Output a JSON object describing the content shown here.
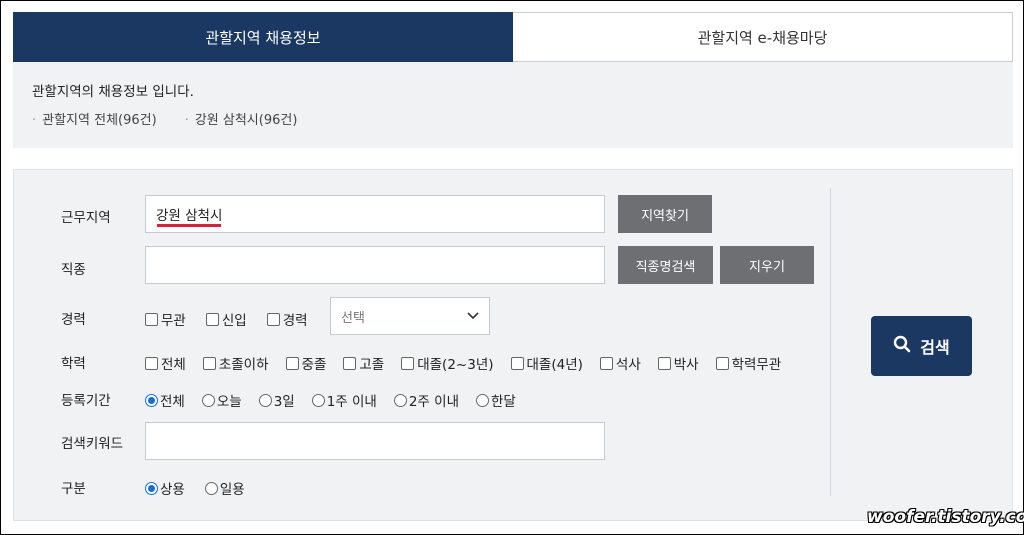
{
  "tabs": [
    {
      "label": "관할지역 채용정보",
      "active": true
    },
    {
      "label": "관할지역 e-채용마당",
      "active": false
    }
  ],
  "info": {
    "title": "관할지역의 채용정보 입니다.",
    "items": [
      "관할지역 전체(96건)",
      "강원 삼척시(96건)"
    ]
  },
  "form": {
    "region": {
      "label": "근무지역",
      "value": "강원 삼척시",
      "find_button": "지역찾기"
    },
    "job": {
      "label": "직종",
      "value": "",
      "search_button": "직종명검색",
      "clear_button": "지우기"
    },
    "career": {
      "label": "경력",
      "options": [
        "무관",
        "신입",
        "경력"
      ],
      "select_value": "선택"
    },
    "education": {
      "label": "학력",
      "options": [
        "전체",
        "초졸이하",
        "중졸",
        "고졸",
        "대졸(2~3년)",
        "대졸(4년)",
        "석사",
        "박사",
        "학력무관"
      ]
    },
    "period": {
      "label": "등록기간",
      "options": [
        "전체",
        "오늘",
        "3일",
        "1주 이내",
        "2주 이내",
        "한달"
      ],
      "selected": "전체"
    },
    "keyword": {
      "label": "검색키워드",
      "value": ""
    },
    "type": {
      "label": "구분",
      "options": [
        "상용",
        "일용"
      ],
      "selected": "상용"
    }
  },
  "search_button": "검색",
  "watermark": "woofer.tistory.com",
  "colors": {
    "primary": "#1b3863",
    "gray_button": "#6d6f73",
    "panel_bg": "#f1f2f4",
    "accent_underline": "#d6213a"
  },
  "icons": {
    "search": "search-icon",
    "dropdown": "chevron-down-icon"
  }
}
